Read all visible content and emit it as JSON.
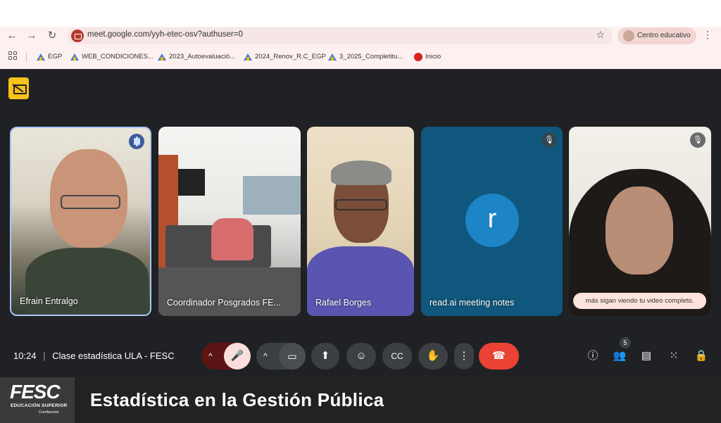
{
  "browser": {
    "url": "meet.google.com/yyh-etec-osv?authuser=0",
    "profile_label": "Centro educativo",
    "bookmarks": [
      {
        "label": "EGP",
        "icon": "drive-icon"
      },
      {
        "label": "WEB_CONDICIONES...",
        "icon": "drive-icon"
      },
      {
        "label": "2023_Autoevaluació...",
        "icon": "drive-icon"
      },
      {
        "label": "2024_Renov_R.C_EGP",
        "icon": "drive-icon"
      },
      {
        "label": "3_2025_Completitu...",
        "icon": "drive-icon"
      },
      {
        "label": "Inicio",
        "icon": "fesc-icon"
      }
    ]
  },
  "meeting": {
    "time": "10:24",
    "separator": "|",
    "title": "Clase estadística ULA - FESC",
    "participant_count": "5",
    "participants": [
      {
        "name": "Efrain Entralgo",
        "speaking": true
      },
      {
        "name": "Coordinador Posgrados FE..."
      },
      {
        "name": "Rafael Borges"
      },
      {
        "name": "read.ai meeting notes",
        "avatar_letter": "r",
        "muted": true,
        "avatar_color": "#1d84c6"
      },
      {
        "name": "",
        "muted": true,
        "caption": "más sigan viendo tu video completo."
      }
    ],
    "colors": {
      "end_call": "#ea4335",
      "mic_off": "#f9dedc",
      "background": "#202124"
    }
  },
  "banner": {
    "logo_text": "FESC",
    "logo_sub": "EDUCACIÓN SUPERIOR",
    "logo_brand": "Comfanorte",
    "title": "Estadística en la Gestión Pública"
  }
}
